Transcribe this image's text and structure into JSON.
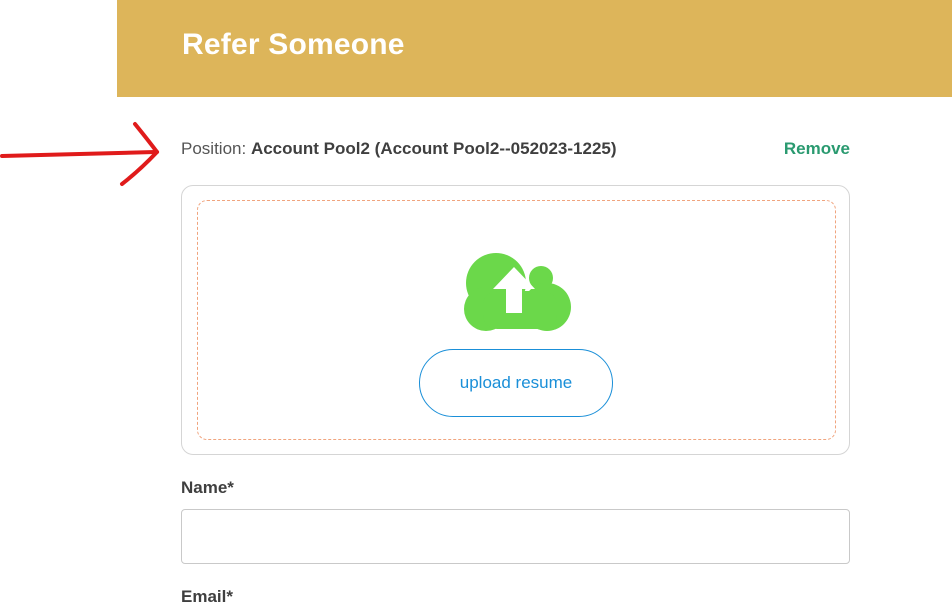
{
  "header": {
    "title": "Refer Someone"
  },
  "position": {
    "label": "Position:",
    "value": "Account Pool2 (Account Pool2--052023-1225)",
    "remove_label": "Remove"
  },
  "upload": {
    "icon": "cloud-upload-icon",
    "button_label": "upload resume"
  },
  "form": {
    "name_label": "Name*",
    "name_value": "",
    "email_label": "Email*"
  },
  "colors": {
    "header_bg": "#ddb55a",
    "remove_link": "#2a9a70",
    "upload_button": "#1a8fd8",
    "cloud_icon": "#6bd84a",
    "annotation_arrow": "#e01b1b"
  }
}
